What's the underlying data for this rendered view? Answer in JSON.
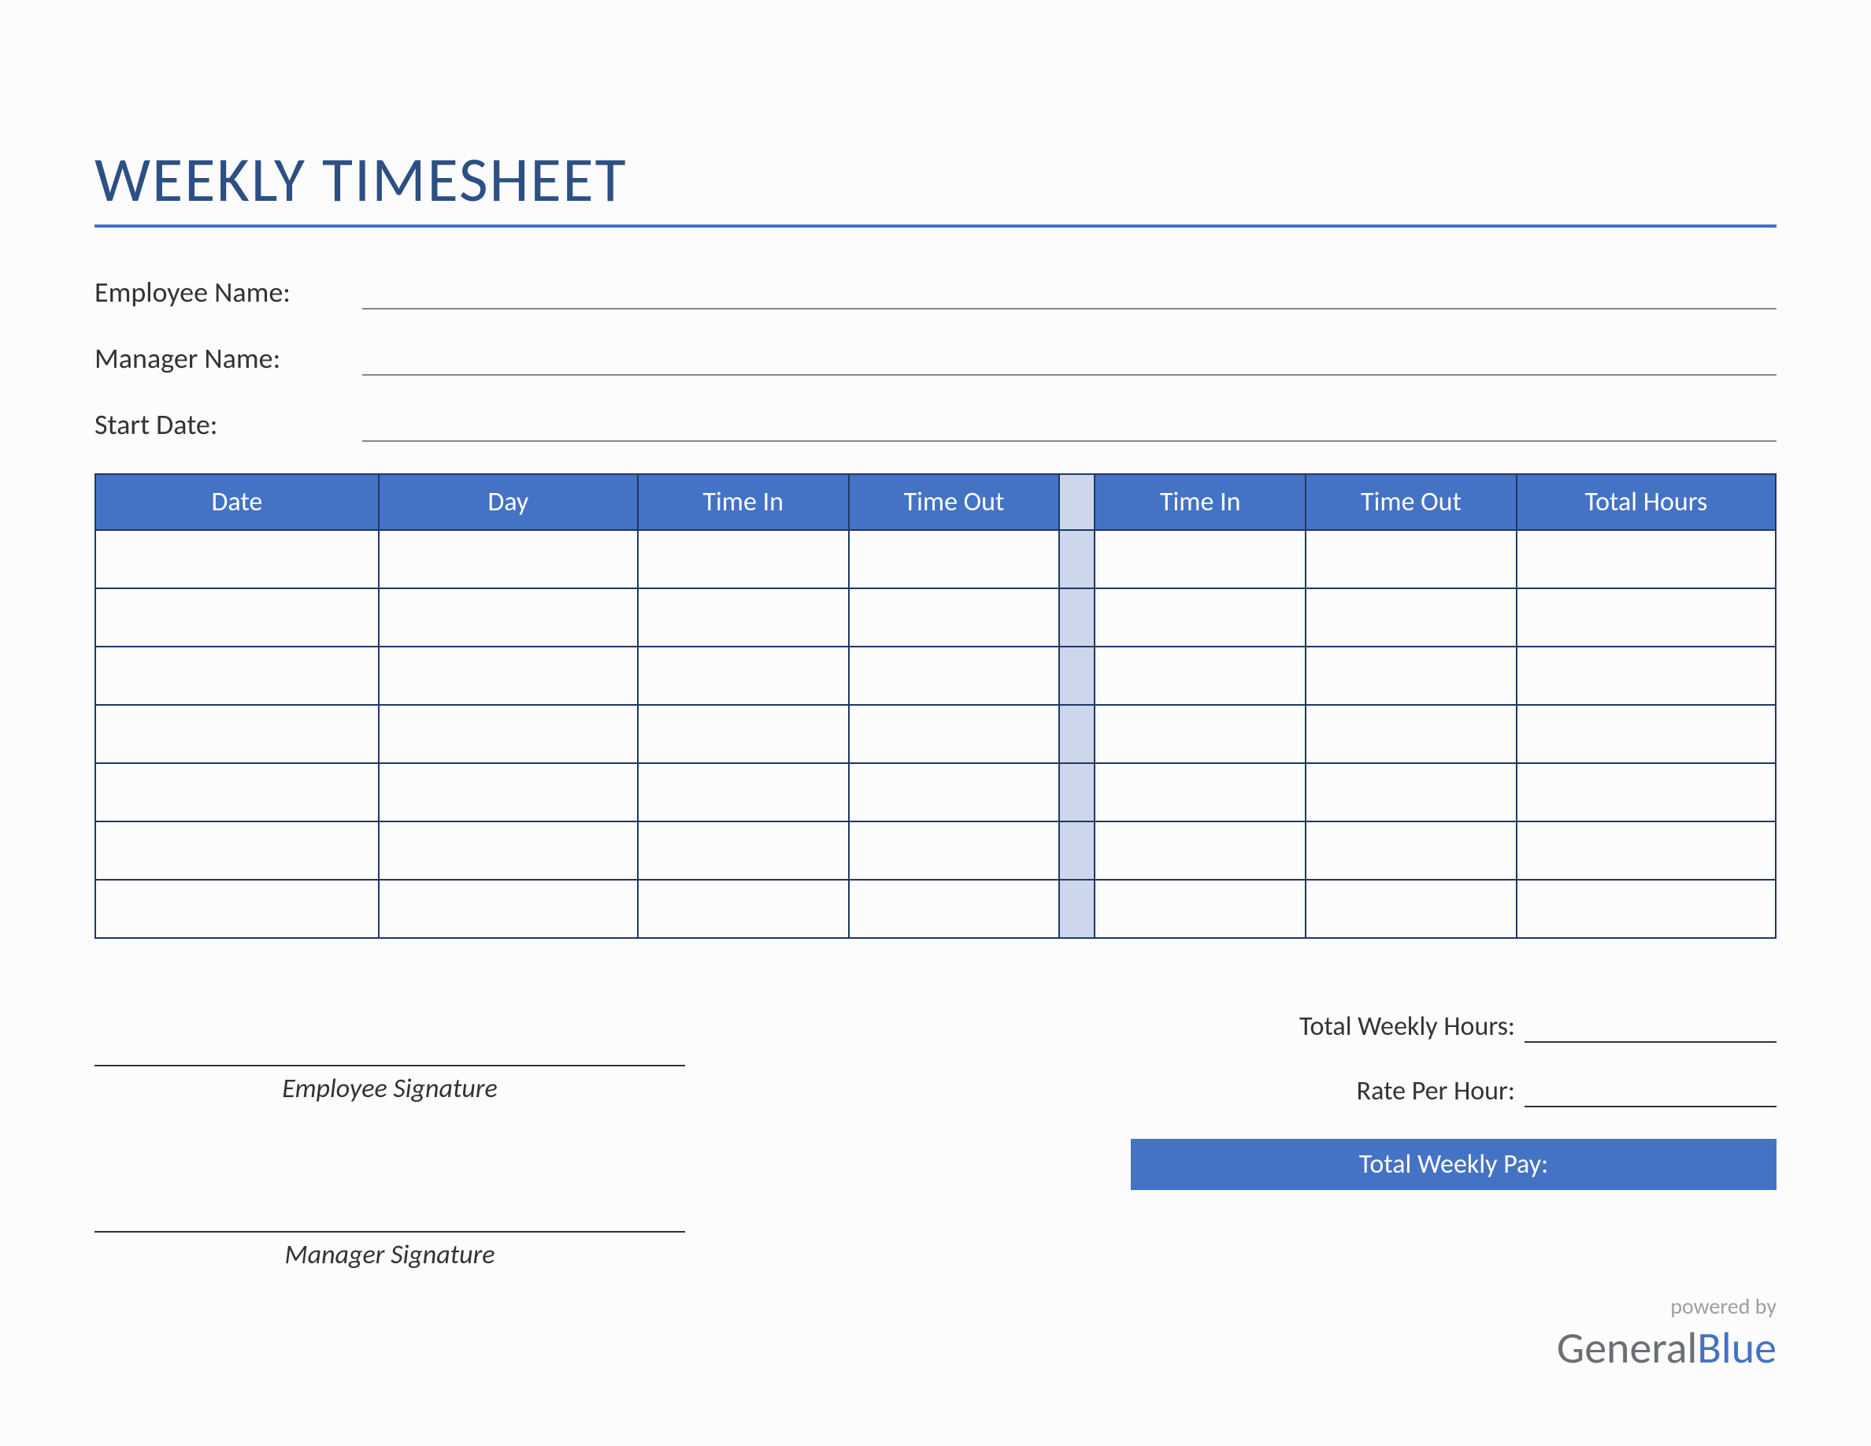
{
  "title": "WEEKLY TIMESHEET",
  "info": {
    "employee_name_label": "Employee Name:",
    "manager_name_label": "Manager Name:",
    "start_date_label": "Start Date:"
  },
  "table": {
    "headers": {
      "date": "Date",
      "day": "Day",
      "time_in_1": "Time In",
      "time_out_1": "Time Out",
      "time_in_2": "Time In",
      "time_out_2": "Time Out",
      "total": "Total Hours"
    },
    "row_count": 7
  },
  "signatures": {
    "employee": "Employee Signature",
    "manager": "Manager Signature"
  },
  "summary": {
    "total_hours_label": "Total Weekly Hours:",
    "rate_label": "Rate Per Hour:",
    "total_pay_label": "Total Weekly Pay:"
  },
  "footer": {
    "powered": "powered by",
    "brand_1": "General",
    "brand_2": "Blue"
  }
}
